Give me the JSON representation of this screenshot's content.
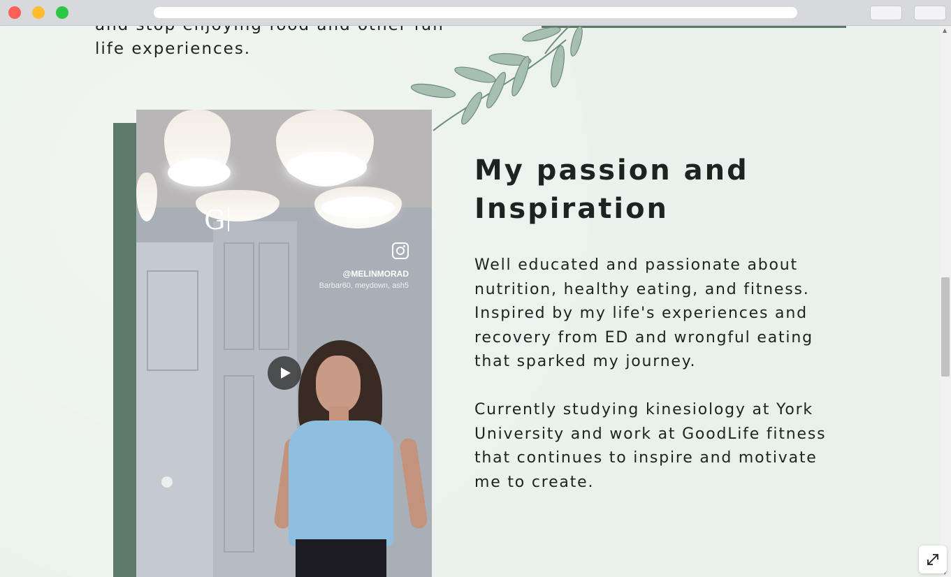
{
  "page": {
    "previous_text": "and stop enjoying food and other fun life experiences."
  },
  "video": {
    "logo_letter": "G",
    "handle": "@MELINMORAD",
    "tags": "Barbar60, meydown, ash5"
  },
  "section": {
    "heading": "My passion and Inspiration",
    "paragraph_1": "Well educated and passionate about nutrition, healthy eating, and fitness. Inspired by my life's experiences and recovery from ED and wrongful eating that sparked my journey.",
    "paragraph_2": "Currently studying kinesiology at York University and work at GoodLife fitness that continues to inspire and motivate me to create."
  },
  "colors": {
    "accent_green": "#5b7a6a",
    "background": "#eaf1ec",
    "text": "#1c2320"
  },
  "icons": {
    "play": "play-icon",
    "instagram": "instagram-icon",
    "expand": "expand-icon",
    "leaf_branch": "leaf-branch-icon"
  }
}
